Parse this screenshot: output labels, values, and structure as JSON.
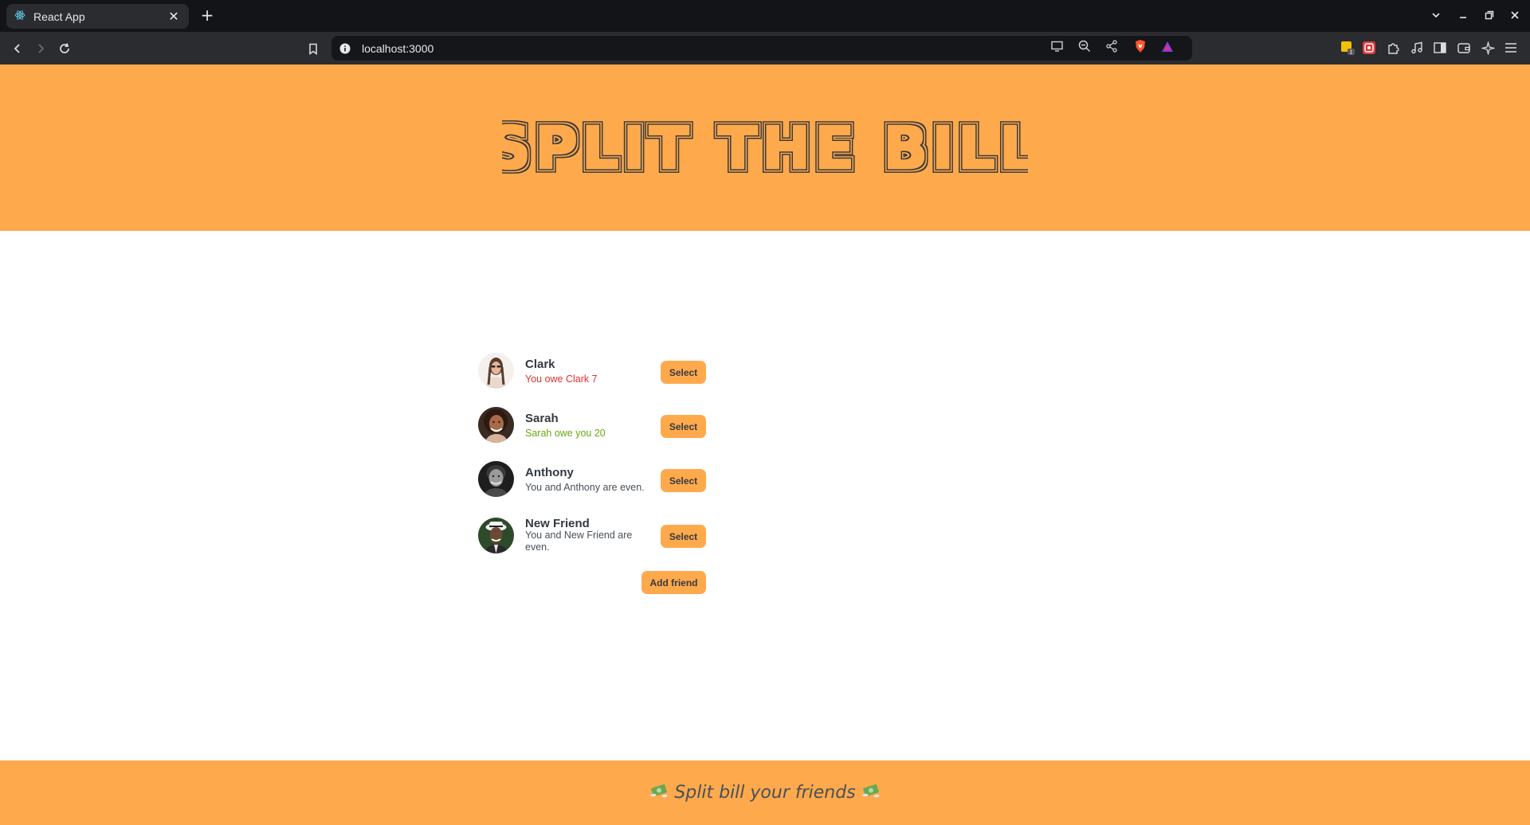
{
  "browser": {
    "tab_title": "React App",
    "url": "localhost:3000",
    "extension_badge": "1"
  },
  "app": {
    "title": "SPLIT THE BILL",
    "footer_text": "Split bill your friends",
    "accent_color": "#ffa94d",
    "friends": [
      {
        "name": "Clark",
        "status": "You owe Clark 7",
        "status_type": "owe",
        "button": "Select"
      },
      {
        "name": "Sarah",
        "status": "Sarah owe you 20",
        "status_type": "owed",
        "button": "Select"
      },
      {
        "name": "Anthony",
        "status": "You and Anthony are even.",
        "status_type": "even",
        "button": "Select"
      },
      {
        "name": "New Friend",
        "status": "You and New Friend are even.",
        "status_type": "even",
        "button": "Select"
      }
    ],
    "add_friend_label": "Add friend"
  }
}
